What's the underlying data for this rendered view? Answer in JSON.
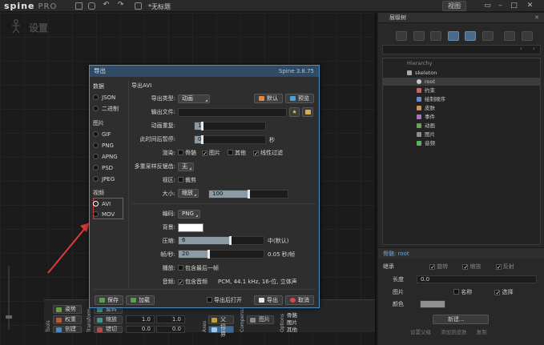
{
  "app": {
    "logo": "spine",
    "edition": "PRO",
    "file_title": "*无标题",
    "view_menu": "视图"
  },
  "viewport": {
    "title": "设置"
  },
  "bottom_tools": {
    "tools_section": "Tools",
    "transform_section": "Transform",
    "axes_section": "Axes",
    "compensate_section": "Compensate",
    "options_section": "Options",
    "pose": "姿势",
    "weights": "权重",
    "create": "创建",
    "rotate": "旋转",
    "scale": "缩放",
    "shear": "错切",
    "scale_x": "1.0",
    "scale_y": "1.0",
    "shear_x": "0.0",
    "shear_y": "0.0",
    "parent": "父级",
    "world": "世界",
    "images": "图片",
    "bones": "骨骼",
    "images2": "图片",
    "others": "其他"
  },
  "hierarchy": {
    "panel_title": "层级树",
    "header": "Hierarchy",
    "items": [
      {
        "label": "skeleton",
        "icon": "skeleton-icon"
      },
      {
        "label": "root",
        "icon": "bone-icon"
      },
      {
        "label": "约束",
        "icon": "constraint-icon"
      },
      {
        "label": "绘制顺序",
        "icon": "draw-order-icon"
      },
      {
        "label": "皮肤",
        "icon": "skin-icon"
      },
      {
        "label": "事件",
        "icon": "event-icon"
      },
      {
        "label": "动画",
        "icon": "animation-icon"
      },
      {
        "label": "图片",
        "icon": "image-icon"
      },
      {
        "label": "音频",
        "icon": "audio-icon"
      }
    ]
  },
  "bone_panel": {
    "title": "骨骼: root",
    "inherit": "继承",
    "rotate": "旋转",
    "scale": "缩放",
    "reflect": "反射",
    "length_label": "长度",
    "length_value": "0.0",
    "images_label": "图片",
    "name_label": "名称",
    "select_label": "选择",
    "color_label": "颜色",
    "new_button": "新建...",
    "set_parent": "设置父级",
    "add_to_skin": "添加到皮肤",
    "duplicate": "复制"
  },
  "dialog": {
    "title": "导出",
    "version": "Spine 3.8.75",
    "data_section": "数据",
    "data_formats": [
      "JSON",
      "二进制"
    ],
    "image_section": "图片",
    "image_formats": [
      "GIF",
      "PNG",
      "APNG",
      "PSD",
      "JPEG"
    ],
    "video_section": "视频",
    "video_formats": [
      "AVI",
      "MOV"
    ],
    "selected_format": "AVI",
    "section_heading": "导出AVI",
    "export_type_label": "导出类型:",
    "export_type_value": "动画",
    "default_button": "默认",
    "preview_button": "预览",
    "output_file_label": "输出文件:",
    "output_file_value": "",
    "repeat_label": "动画重复:",
    "repeat_value": "1",
    "pause_label": "此时间后暂停:",
    "pause_value": "0",
    "pause_unit": "秒",
    "render_label": "渲染:",
    "render_options": [
      {
        "label": "骨骼",
        "checked": false
      },
      {
        "label": "图片",
        "checked": true
      },
      {
        "label": "其他",
        "checked": false
      },
      {
        "label": "线性过滤",
        "checked": true
      }
    ],
    "multisample_label": "多重采样反锯齿:",
    "multisample_value": "无",
    "viewport_label": "视区:",
    "crop_label": "裁剪",
    "size_label": "大小:",
    "size_mode": "缩放",
    "size_value": "100",
    "size_fraction": 0.5,
    "codec_label": "编码:",
    "codec_value": "PNG",
    "background_label": "背景:",
    "background_color": "#ffffff",
    "compression_label": "压缩:",
    "compression_value": "6",
    "compression_fraction": 0.6,
    "compression_note": "中(默认)",
    "fps_label": "帧/秒:",
    "fps_value": "20",
    "fps_fraction": 0.3,
    "fps_note": "0.05 秒/帧",
    "playback_label": "播放:",
    "playback_option": "包含最后一帧",
    "audio_label": "音频:",
    "audio_option": "包含音频",
    "audio_format": "PCM, 44.1 kHz, 16-位, 立体声",
    "save_button": "保存",
    "load_button": "加载",
    "open_after_export": "导出后打开",
    "export_button": "导出",
    "cancel_button": "取消"
  },
  "colors": {
    "accent": "#4a90c9",
    "highlight": "#d83a3a",
    "bone_title": "#6fa8dc"
  }
}
